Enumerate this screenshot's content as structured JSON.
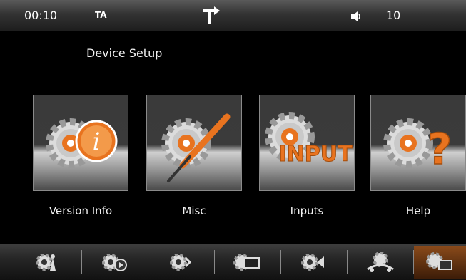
{
  "status": {
    "time": "00:10",
    "ta": "TA",
    "volume": "10",
    "nav_icon": "navigation-turn-icon",
    "speaker_icon": "speaker-icon"
  },
  "page": {
    "title": "Device Setup"
  },
  "tiles": [
    {
      "label": "Version Info",
      "icon": "version-info-gear-icon",
      "glyph": "i"
    },
    {
      "label": "Misc",
      "icon": "misc-gear-wrench-icon"
    },
    {
      "label": "Inputs",
      "icon": "inputs-gear-icon",
      "glyph": "INPUT"
    },
    {
      "label": "Help",
      "icon": "help-gear-icon",
      "glyph": "?"
    }
  ],
  "dock": [
    {
      "icon": "radio-setup-icon"
    },
    {
      "icon": "media-setup-icon"
    },
    {
      "icon": "audio-setup-icon"
    },
    {
      "icon": "display-setup-icon"
    },
    {
      "icon": "camera-setup-icon"
    },
    {
      "icon": "vehicle-setup-icon"
    },
    {
      "icon": "device-setup-icon",
      "active": true
    }
  ],
  "colors": {
    "accent": "#e8731f",
    "tile_border": "#8a8a8a",
    "background": "#000000"
  }
}
